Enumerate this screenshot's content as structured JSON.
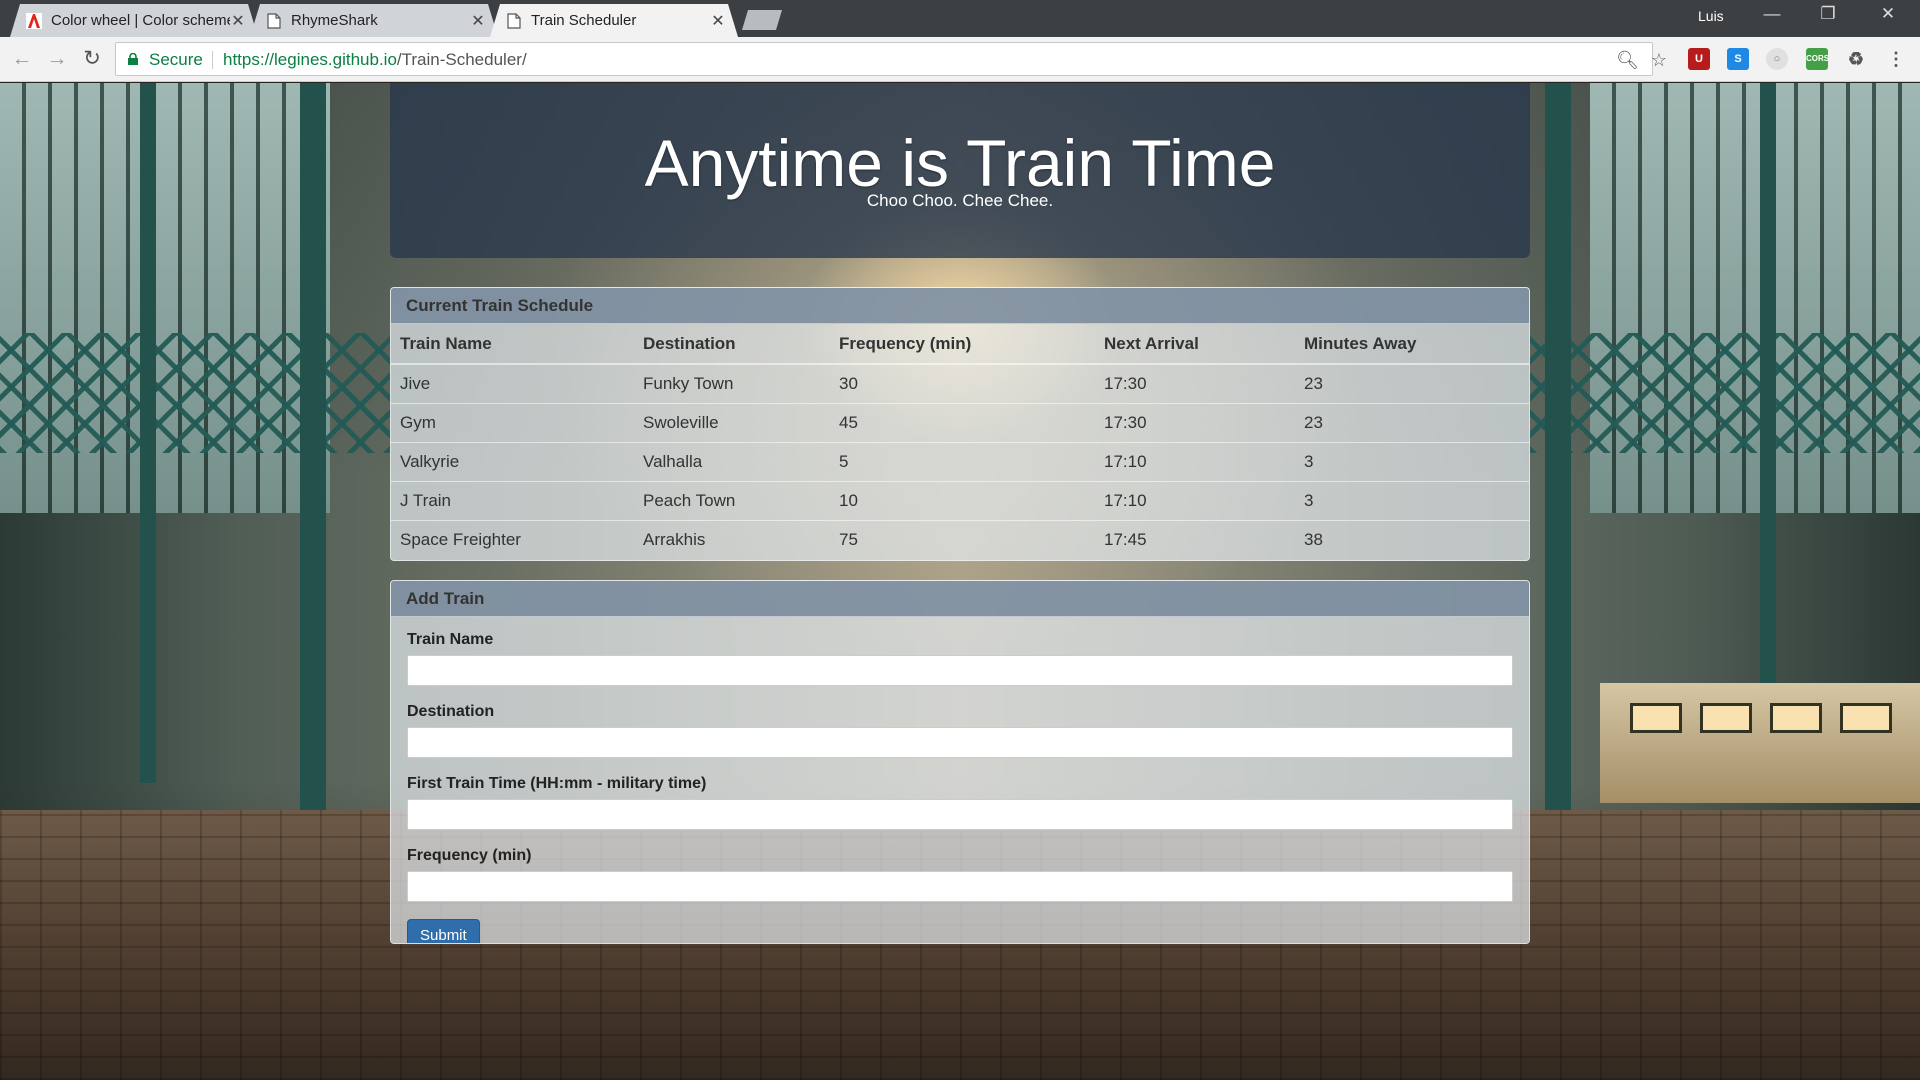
{
  "browser": {
    "tabs": [
      {
        "title": "Color wheel | Color schemes",
        "icon": "adobe-icon"
      },
      {
        "title": "RhymeShark",
        "icon": "page-icon"
      },
      {
        "title": "Train Scheduler",
        "icon": "page-icon",
        "active": true
      }
    ],
    "profile_name": "Luis",
    "security_label": "Secure",
    "url_host": "https://legines.github.io",
    "url_path": "/Train-Scheduler/"
  },
  "header": {
    "title": "Anytime is Train Time",
    "subtitle": "Choo Choo. Chee Chee."
  },
  "schedule": {
    "heading": "Current Train Schedule",
    "columns": [
      "Train Name",
      "Destination",
      "Frequency (min)",
      "Next Arrival",
      "Minutes Away"
    ],
    "rows": [
      [
        "Jive",
        "Funky Town",
        "30",
        "17:30",
        "23"
      ],
      [
        "Gym",
        "Swoleville",
        "45",
        "17:30",
        "23"
      ],
      [
        "Valkyrie",
        "Valhalla",
        "5",
        "17:10",
        "3"
      ],
      [
        "J Train",
        "Peach Town",
        "10",
        "17:10",
        "3"
      ],
      [
        "Space Freighter",
        "Arrakhis",
        "75",
        "17:45",
        "38"
      ]
    ]
  },
  "add_train": {
    "heading": "Add Train",
    "fields": [
      {
        "label": "Train Name",
        "value": ""
      },
      {
        "label": "Destination",
        "value": ""
      },
      {
        "label": "First Train Time (HH:mm - military time)",
        "value": ""
      },
      {
        "label": "Frequency (min)",
        "value": ""
      }
    ],
    "submit_label": "Submit"
  },
  "colors": {
    "jumbotron": "#283a4b",
    "panel_heading": "#6e8296",
    "submit_button": "#2f6eaa",
    "secure_green": "#0b8043"
  }
}
